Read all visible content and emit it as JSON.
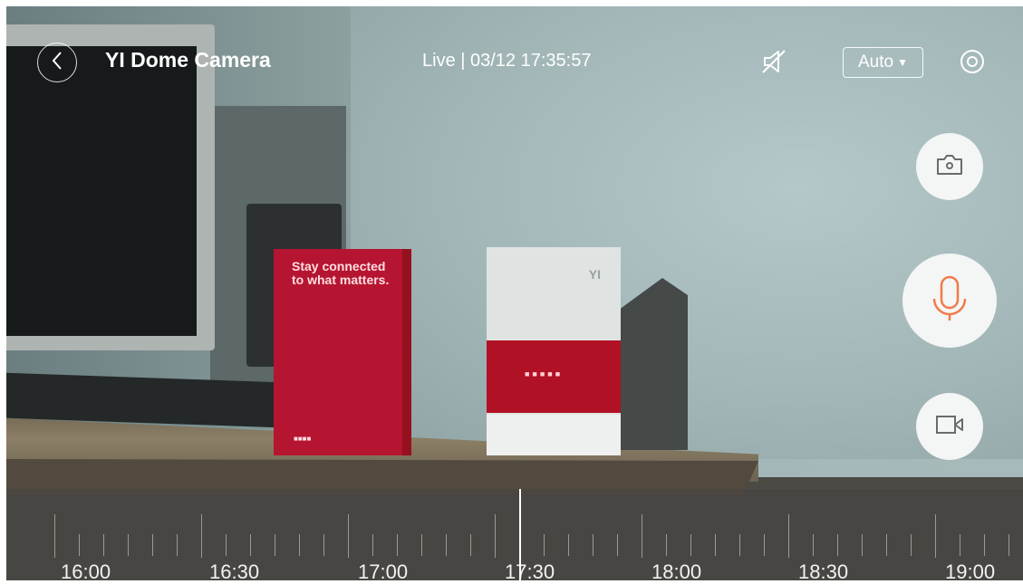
{
  "header": {
    "title": "YI Dome Camera",
    "live_status": "Live | 03/12 17:35:57",
    "quality_label": "Auto",
    "quality_caret": "▼"
  },
  "icons": {
    "back": "chevron-left-icon",
    "mute": "speaker-muted-icon",
    "settings": "settings-ring-icon",
    "snapshot": "camera-icon",
    "microphone": "microphone-icon",
    "record": "video-camera-icon"
  },
  "colors": {
    "mic_accent": "#f07b4a",
    "button_bg": "#f4f5f5",
    "icon_gray": "#6b6b6b"
  },
  "scene": {
    "card_text": "Stay connected to what matters.",
    "box_logo": "YI"
  },
  "timeline": {
    "labels": [
      "16:00",
      "16:30",
      "17:00",
      "17:30",
      "18:00",
      "18:30",
      "19:00"
    ],
    "current_time": "17:35:57"
  }
}
